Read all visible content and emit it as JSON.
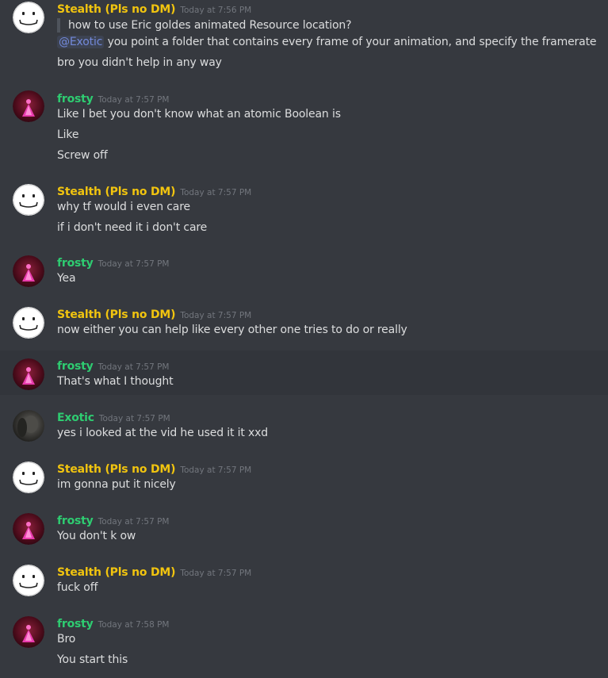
{
  "colors": {
    "background": "#36393f",
    "highlight_background": "#32353b",
    "stealth_name": "#f1c40f",
    "frosty_name": "#2ecc71",
    "exotic_name": "#2ecc71",
    "mention": "#7289da",
    "timestamp": "#72767d",
    "text": "#dcddde"
  },
  "messages": [
    {
      "author": "Stealth (Pls no DM)",
      "time": "Today at 7:56 PM",
      "avatar": "smiley-face-avatar",
      "quote": "how to use Eric goldes animated Resource location?",
      "mention": "@Exotic",
      "mention_rest": " you point a folder that contains every frame of your animation, and specify the framerate",
      "lines": [
        "bro you didn't help in any way"
      ]
    },
    {
      "author": "frosty",
      "time": "Today at 7:57 PM",
      "avatar": "pink-figure-avatar",
      "lines": [
        "Like I bet you don't know what an atomic Boolean is",
        "Like",
        "Screw off"
      ]
    },
    {
      "author": "Stealth (Pls no DM)",
      "time": "Today at 7:57 PM",
      "avatar": "smiley-face-avatar",
      "lines": [
        "why tf would i even care",
        "if i don't need it i don't care"
      ]
    },
    {
      "author": "frosty",
      "time": "Today at 7:57 PM",
      "avatar": "pink-figure-avatar",
      "lines": [
        "Yea"
      ]
    },
    {
      "author": "Stealth (Pls no DM)",
      "time": "Today at 7:57 PM",
      "avatar": "smiley-face-avatar",
      "lines": [
        "now either you can help like every other one tries to do or really"
      ]
    },
    {
      "author": "frosty",
      "time": "Today at 7:57 PM",
      "avatar": "pink-figure-avatar",
      "lines": [
        "That's what I thought"
      ]
    },
    {
      "author": "Exotic",
      "time": "Today at 7:57 PM",
      "avatar": "dark-photo-avatar",
      "lines": [
        "yes i looked at the vid he used it it xxd"
      ]
    },
    {
      "author": "Stealth (Pls no DM)",
      "time": "Today at 7:57 PM",
      "avatar": "smiley-face-avatar",
      "lines": [
        "im gonna put it nicely"
      ]
    },
    {
      "author": "frosty",
      "time": "Today at 7:57 PM",
      "avatar": "pink-figure-avatar",
      "lines": [
        "You don't k ow"
      ]
    },
    {
      "author": "Stealth (Pls no DM)",
      "time": "Today at 7:57 PM",
      "avatar": "smiley-face-avatar",
      "lines": [
        "fuck off"
      ]
    },
    {
      "author": "frosty",
      "time": "Today at 7:58 PM",
      "avatar": "pink-figure-avatar",
      "lines": [
        "Bro",
        "You start this"
      ]
    }
  ]
}
